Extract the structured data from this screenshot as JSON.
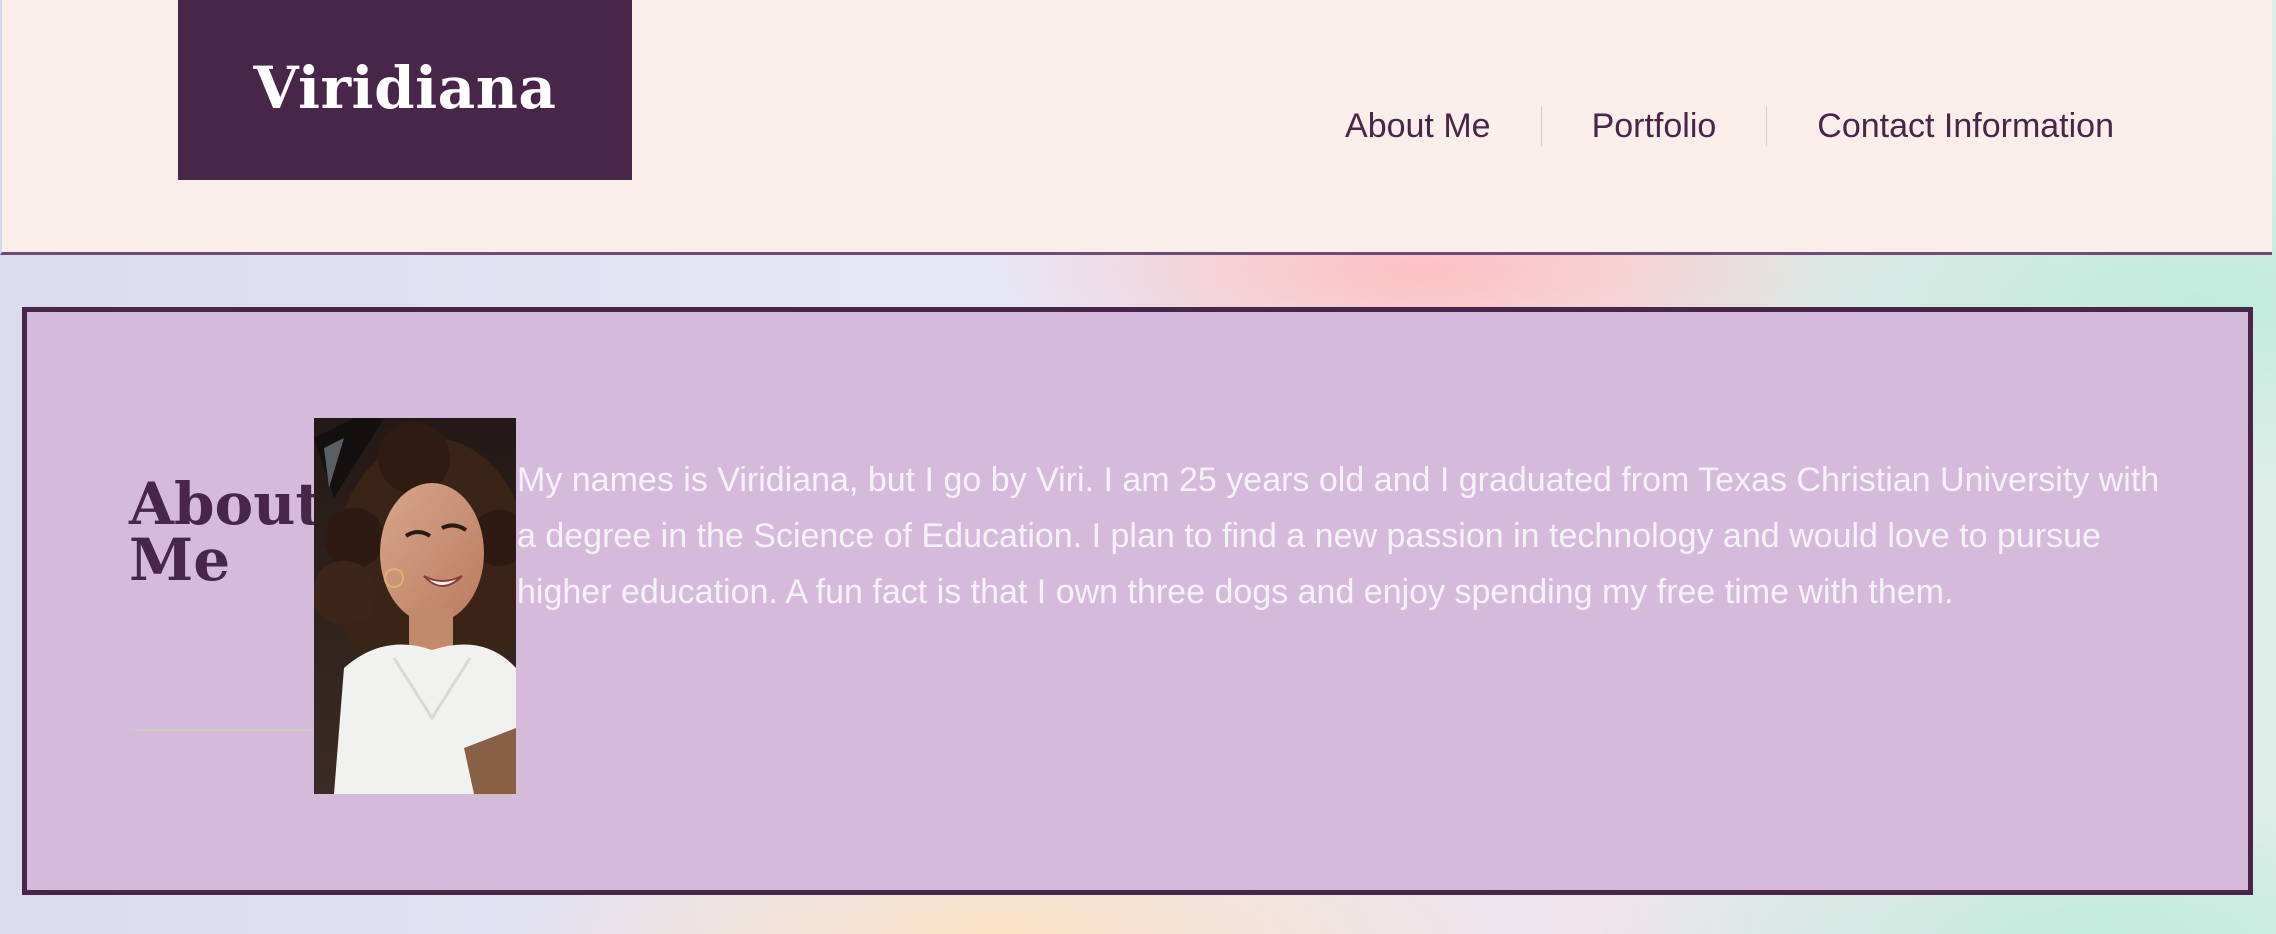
{
  "header": {
    "brand": "Viridiana",
    "nav": [
      {
        "label": "About Me"
      },
      {
        "label": "Portfolio"
      },
      {
        "label": "Contact Information"
      }
    ]
  },
  "about": {
    "title": "About Me",
    "photo_alt": "Portrait photo of Viridiana",
    "text": "My names is Viridiana, but I go by Viri. I am 25 years old and I graduated from Texas Christian University with a degree in the Science of Education. I plan to find a new passion in technology and would love to pursue higher education. A fun fact is that I own three dogs and enjoy spending my free time with them."
  },
  "colors": {
    "brand_bg": "#48264a",
    "header_bg": "#f9eee9",
    "panel_bg": "#d5badb",
    "panel_border": "#48264a",
    "body_text_light": "#f5f2f7"
  }
}
